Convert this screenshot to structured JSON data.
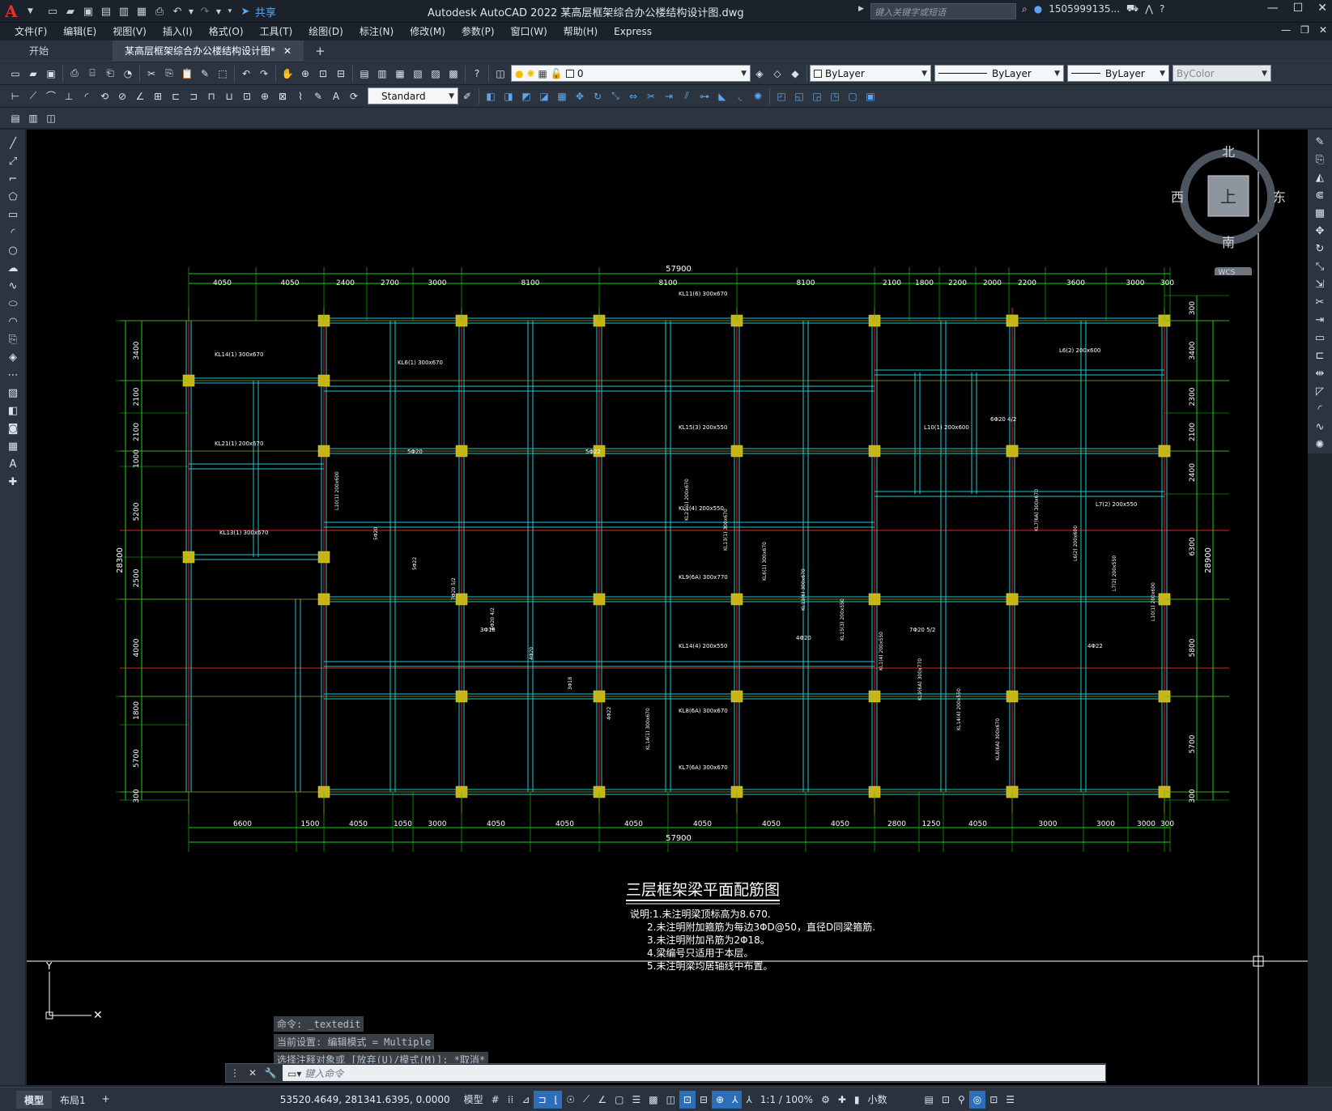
{
  "titlebar": {
    "app_logo": "A",
    "share_label": "共享",
    "title": "Autodesk AutoCAD 2022    某高层框架综合办公楼结构设计图.dwg",
    "search_placeholder": "键入关键字或短语",
    "user": "1505999135...",
    "icons": [
      "new-icon",
      "open-icon",
      "save-icon",
      "saveas-icon",
      "plot-icon",
      "undo-icon",
      "redo-icon",
      "share-icon"
    ]
  },
  "menu": [
    "文件(F)",
    "编辑(E)",
    "视图(V)",
    "插入(I)",
    "格式(O)",
    "工具(T)",
    "绘图(D)",
    "标注(N)",
    "修改(M)",
    "参数(P)",
    "窗口(W)",
    "帮助(H)",
    "Express"
  ],
  "tabs": [
    {
      "label": "开始",
      "active": false
    },
    {
      "label": "某高层框架综合办公楼结构设计图*",
      "active": true
    }
  ],
  "toolbar": {
    "layer_value": "0",
    "color_value": "ByLayer",
    "linetype_value": "ByLayer",
    "lineweight_value": "ByLayer",
    "plotstyle_value": "ByColor",
    "textstyle_value": "Standard"
  },
  "viewcube": {
    "north": "北",
    "south": "南",
    "east": "东",
    "west": "西",
    "face": "上",
    "wcs": "WCS"
  },
  "drawing": {
    "title": "三层框架梁平面配筋图",
    "notes": [
      "说明:1.未注明梁顶标高为8.670.",
      "2.未注明附加箍筋为每边3ΦD@50，直径D同梁箍筋.",
      "3.未注明附加吊筋为2Φ18。",
      "4.梁编号只适用于本层。",
      "5.未注明梁均居轴线中布置。"
    ],
    "top_total": "57900",
    "bottom_total": "57900",
    "top_dims": [
      "4050",
      "4050",
      "2400",
      "2700",
      "3000",
      "8100",
      "8100",
      "8100",
      "2100",
      "1800",
      "2200",
      "2000",
      "2200",
      "3600",
      "3000",
      "300"
    ],
    "bottom_dims": [
      "6600",
      "1500",
      "4050",
      "1050",
      "3000",
      "4050",
      "4050",
      "4050",
      "4050",
      "4050",
      "4050",
      "2800",
      "1250",
      "4050",
      "3000",
      "3000",
      "3000",
      "300"
    ],
    "left_dims": [
      "3400",
      "2100",
      "2100",
      "1000",
      "5200",
      "2500",
      "4000",
      "1800",
      "5700",
      "300"
    ],
    "left_total": "28300",
    "right_dims": [
      "300",
      "3400",
      "2300",
      "2100",
      "2400",
      "6300",
      "5800",
      "5700",
      "300"
    ],
    "right_total": "28900",
    "beam_labels": [
      "KL14(1) 300x670",
      "KL21(1) 200x670",
      "KL13(1) 300x670",
      "KL6(1) 300x670",
      "KL11(6) 300x670",
      "KL15(3) 200x550",
      "KL1(4) 200x550",
      "KL9(6A) 300x770",
      "KL14(4) 200x550",
      "KL8(6A) 300x670",
      "KL7(6A) 300x670",
      "L6(2) 200x600",
      "L7(2) 200x550",
      "L10(1) 200x600",
      "5Φ20",
      "5Φ22",
      "7Φ20 5/2",
      "6Φ20 4/2",
      "4Φ20",
      "3Φ18",
      "4Φ22"
    ]
  },
  "command": {
    "history": [
      "命令: _textedit",
      "当前设置: 编辑模式 = Multiple",
      "选择注释对象或 [放弃(U)/模式(M)]: *取消*"
    ],
    "placeholder": "键入命令"
  },
  "status": {
    "layout_tabs": [
      {
        "label": "模型",
        "active": true
      },
      {
        "label": "布局1",
        "active": false
      }
    ],
    "coords": "53520.4649, 281341.6395, 0.0000",
    "model_label": "模型",
    "scale": "1:1 / 100%",
    "units": "小数"
  }
}
